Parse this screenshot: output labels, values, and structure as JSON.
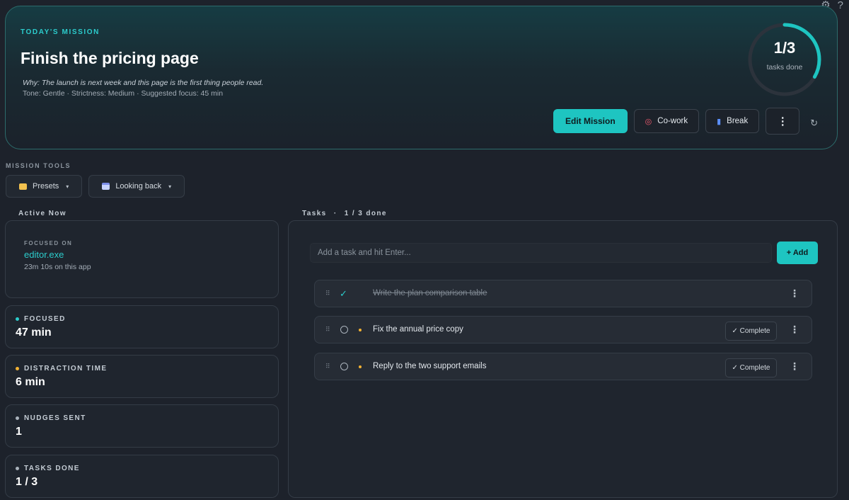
{
  "corner": {
    "settings_icon": "gear-icon",
    "help_label": "?"
  },
  "mission": {
    "kicker": "TODAY'S MISSION",
    "title": "Finish the pricing page",
    "why": "Why: The launch is next week and this page is the first thing people read.",
    "meta": "Tone: Gentle · Strictness: Medium · Suggested focus: 45 min",
    "progress": {
      "done": 1,
      "total": 3,
      "fraction": 0.333,
      "display": "1/3",
      "label": "tasks done"
    },
    "actions": {
      "edit_label": "Edit Mission",
      "cowork_label": "Co-work",
      "break_label": "Break",
      "more_label": "⋮",
      "refresh_label": "↻"
    }
  },
  "tools": {
    "section_label": "MISSION TOOLS",
    "presets_label": "Presets",
    "looking_back_label": "Looking back",
    "caret": "▾"
  },
  "active": {
    "section_label": "Active Now",
    "focused_on_label": "FOCUSED ON",
    "app_name": "editor.exe",
    "app_time": "23m 10s on this app",
    "stats": [
      {
        "label": "FOCUSED",
        "value": "47 min",
        "color": "#2ccccc"
      },
      {
        "label": "DISTRACTION TIME",
        "value": "6 min",
        "color": "#f2b233"
      },
      {
        "label": "NUDGES SENT",
        "value": "1",
        "color": "#aab3bc"
      },
      {
        "label": "TASKS DONE",
        "value": "1 / 3",
        "color": "#aab3bc"
      }
    ]
  },
  "tasks": {
    "section_label": "Tasks",
    "count_label": "1 / 3 done",
    "separator": "·",
    "input_placeholder": "Add a task and hit Enter...",
    "add_label": "+ Add",
    "drag_glyph": "⠿",
    "check_glyph": "✓",
    "more_glyph": "⋮",
    "complete_label": "✓ Complete",
    "items": [
      {
        "text": "Write the plan comparison table",
        "done": true
      },
      {
        "text": "Fix the annual price copy",
        "done": false
      },
      {
        "text": "Reply to the two support emails",
        "done": false
      }
    ]
  },
  "colors": {
    "accent": "#1ec5c1",
    "priority": "#f2b233",
    "background": "#1d222b"
  }
}
